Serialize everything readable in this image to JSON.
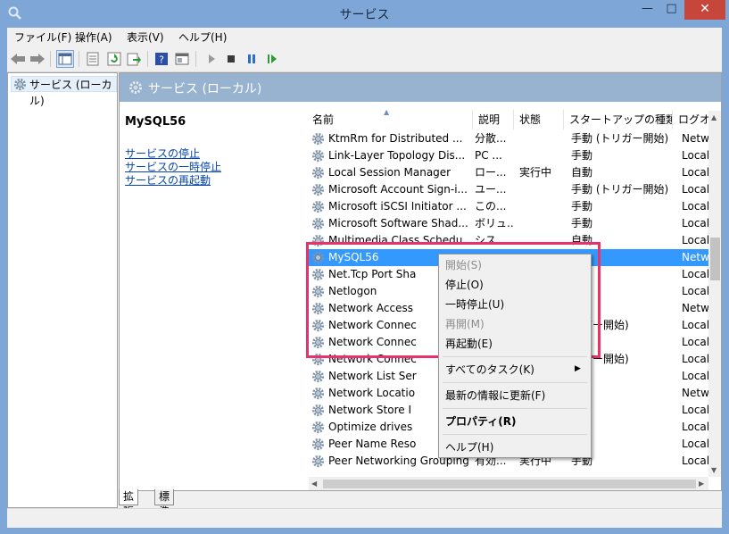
{
  "window": {
    "title": "サービス",
    "minimize": "—",
    "maximize": "□",
    "close": "✕"
  },
  "menubar": {
    "items": [
      "ファイル(F)",
      "操作(A)",
      "表示(V)",
      "ヘルプ(H)"
    ]
  },
  "tree": {
    "root_label": "サービス (ローカル)"
  },
  "main": {
    "header_title": "サービス (ローカル)",
    "selected_service": "MySQL56",
    "links": [
      "サービスの停止",
      "サービスの一時停止",
      "サービスの再起動"
    ]
  },
  "columns": [
    "名前",
    "説明",
    "状態",
    "スタートアップの種類",
    "ログオン"
  ],
  "rows": [
    {
      "name": "KtmRm for Distributed ...",
      "desc": "分散...",
      "status": "",
      "startup": "手動 (トリガー開始)",
      "logon": "Netw..."
    },
    {
      "name": "Link-Layer Topology Dis...",
      "desc": "PC ...",
      "status": "",
      "startup": "手動",
      "logon": "Local"
    },
    {
      "name": "Local Session Manager",
      "desc": "ロー...",
      "status": "実行中",
      "startup": "自動",
      "logon": "Local"
    },
    {
      "name": "Microsoft Account Sign-i...",
      "desc": "ユー...",
      "status": "",
      "startup": "手動 (トリガー開始)",
      "logon": "Local"
    },
    {
      "name": "Microsoft iSCSI Initiator ...",
      "desc": "この...",
      "status": "",
      "startup": "手動",
      "logon": "Local"
    },
    {
      "name": "Microsoft Software Shad...",
      "desc": "ボリュ...",
      "status": "",
      "startup": "手動",
      "logon": "Local"
    },
    {
      "name": "Multimedia Class Schedu...",
      "desc": "シス...",
      "status": "",
      "startup": "自動",
      "logon": "Local"
    },
    {
      "name": "MySQL56",
      "desc": "",
      "status": "",
      "startup": "",
      "logon": "Netw..."
    },
    {
      "name": "Net.Tcp Port Sha",
      "desc": "",
      "status": "",
      "startup": "",
      "logon": "Local"
    },
    {
      "name": "Netlogon",
      "desc": "",
      "status": "",
      "startup": "",
      "logon": "Local"
    },
    {
      "name": "Network Access",
      "desc": "",
      "status": "",
      "startup": "",
      "logon": "Netw..."
    },
    {
      "name": "Network Connec",
      "desc": "",
      "status": "",
      "startup": "リガー開始)",
      "logon": "Local"
    },
    {
      "name": "Network Connec",
      "desc": "",
      "status": "",
      "startup": "",
      "logon": "Local"
    },
    {
      "name": "Network Connec",
      "desc": "",
      "status": "",
      "startup": "リガー開始)",
      "logon": "Local"
    },
    {
      "name": "Network List Ser",
      "desc": "",
      "status": "",
      "startup": "",
      "logon": "Local"
    },
    {
      "name": "Network Locatio",
      "desc": "",
      "status": "",
      "startup": "",
      "logon": "Netw..."
    },
    {
      "name": "Network Store I",
      "desc": "",
      "status": "",
      "startup": "",
      "logon": "Local"
    },
    {
      "name": "Optimize drives",
      "desc": "",
      "status": "",
      "startup": "",
      "logon": "Local"
    },
    {
      "name": "Peer Name Reso",
      "desc": "",
      "status": "",
      "startup": "",
      "logon": "Local"
    },
    {
      "name": "Peer Networking Grouping",
      "desc": "有効...",
      "status": "実行中",
      "startup": "手動",
      "logon": "Local"
    }
  ],
  "context_menu": {
    "items": [
      {
        "label": "開始(S)",
        "disabled": true
      },
      {
        "label": "停止(O)",
        "disabled": false
      },
      {
        "label": "一時停止(U)",
        "disabled": false
      },
      {
        "label": "再開(M)",
        "disabled": true
      },
      {
        "label": "再起動(E)",
        "disabled": false
      },
      {
        "label": "すべてのタスク(K)",
        "disabled": false
      },
      {
        "label": "最新の情報に更新(F)",
        "disabled": false
      },
      {
        "label": "プロパティ(R)",
        "disabled": false
      },
      {
        "label": "ヘルプ(H)",
        "disabled": false
      }
    ]
  },
  "tabs": [
    "拡張",
    "標準"
  ],
  "colors": {
    "titlebar": "#7ea7d8",
    "close_button": "#c7463b",
    "selection": "#3399ff",
    "highlight_box": "#e8336a",
    "header_band": "#97b3d0",
    "link": "#0645ad"
  },
  "icons": [
    "services-gear-icon",
    "back-arrow-icon",
    "forward-arrow-icon",
    "console-tree-icon",
    "properties-icon",
    "refresh-icon",
    "export-icon",
    "help-icon",
    "view-icon",
    "play-icon",
    "stop-icon",
    "pause-icon",
    "resume-icon"
  ]
}
